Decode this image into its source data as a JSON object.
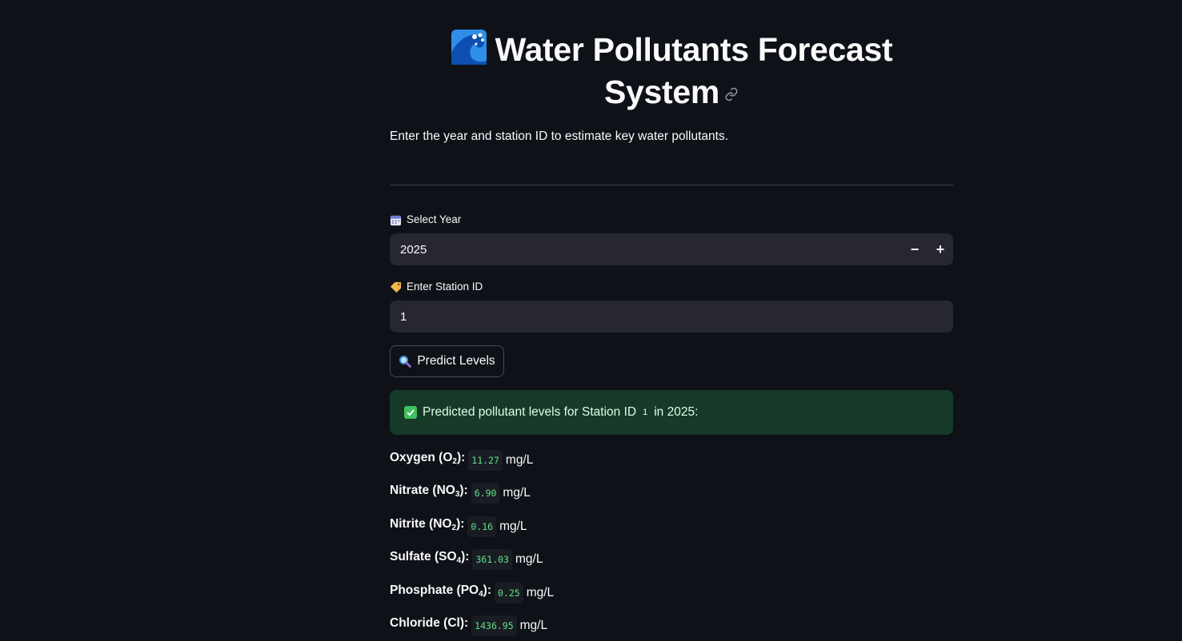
{
  "header": {
    "title_icon": "water-wave-icon",
    "title_line1": "Water Pollutants Forecast",
    "title_line2": "System",
    "subtitle": "Enter the year and station ID to estimate key water pollutants."
  },
  "year_field": {
    "icon": "calendar-icon",
    "label": "Select Year",
    "value": "2025",
    "decrement": "−",
    "increment": "+"
  },
  "station_field": {
    "icon": "label-tag-icon",
    "label": "Enter Station ID",
    "value": "1"
  },
  "predict_button": {
    "icon": "magnifier-icon",
    "label": "Predict Levels"
  },
  "success_message": {
    "icon": "check-mark-icon",
    "prefix": "Predicted pollutant levels for Station ID",
    "station": "1",
    "suffix": "in 2025:"
  },
  "results": [
    {
      "name": "Oxygen (O",
      "sub": "2",
      "close": "):",
      "value": "11.27",
      "unit": "mg/L"
    },
    {
      "name": "Nitrate (NO",
      "sub": "3",
      "close": "):",
      "value": "6.90",
      "unit": "mg/L"
    },
    {
      "name": "Nitrite (NO",
      "sub": "2",
      "close": "):",
      "value": "0.16",
      "unit": "mg/L"
    },
    {
      "name": "Sulfate (SO",
      "sub": "4",
      "close": "):",
      "value": "361.03",
      "unit": "mg/L"
    },
    {
      "name": "Phosphate (PO",
      "sub": "4",
      "close": "):",
      "value": "0.25",
      "unit": "mg/L"
    },
    {
      "name": "Chloride (Cl)",
      "sub": "",
      "close": ":",
      "value": "1436.95",
      "unit": "mg/L"
    }
  ],
  "colors": {
    "background": "#0e1117",
    "input_bg": "#262730",
    "success_bg": "#173928",
    "code_text": "#5ce488"
  }
}
